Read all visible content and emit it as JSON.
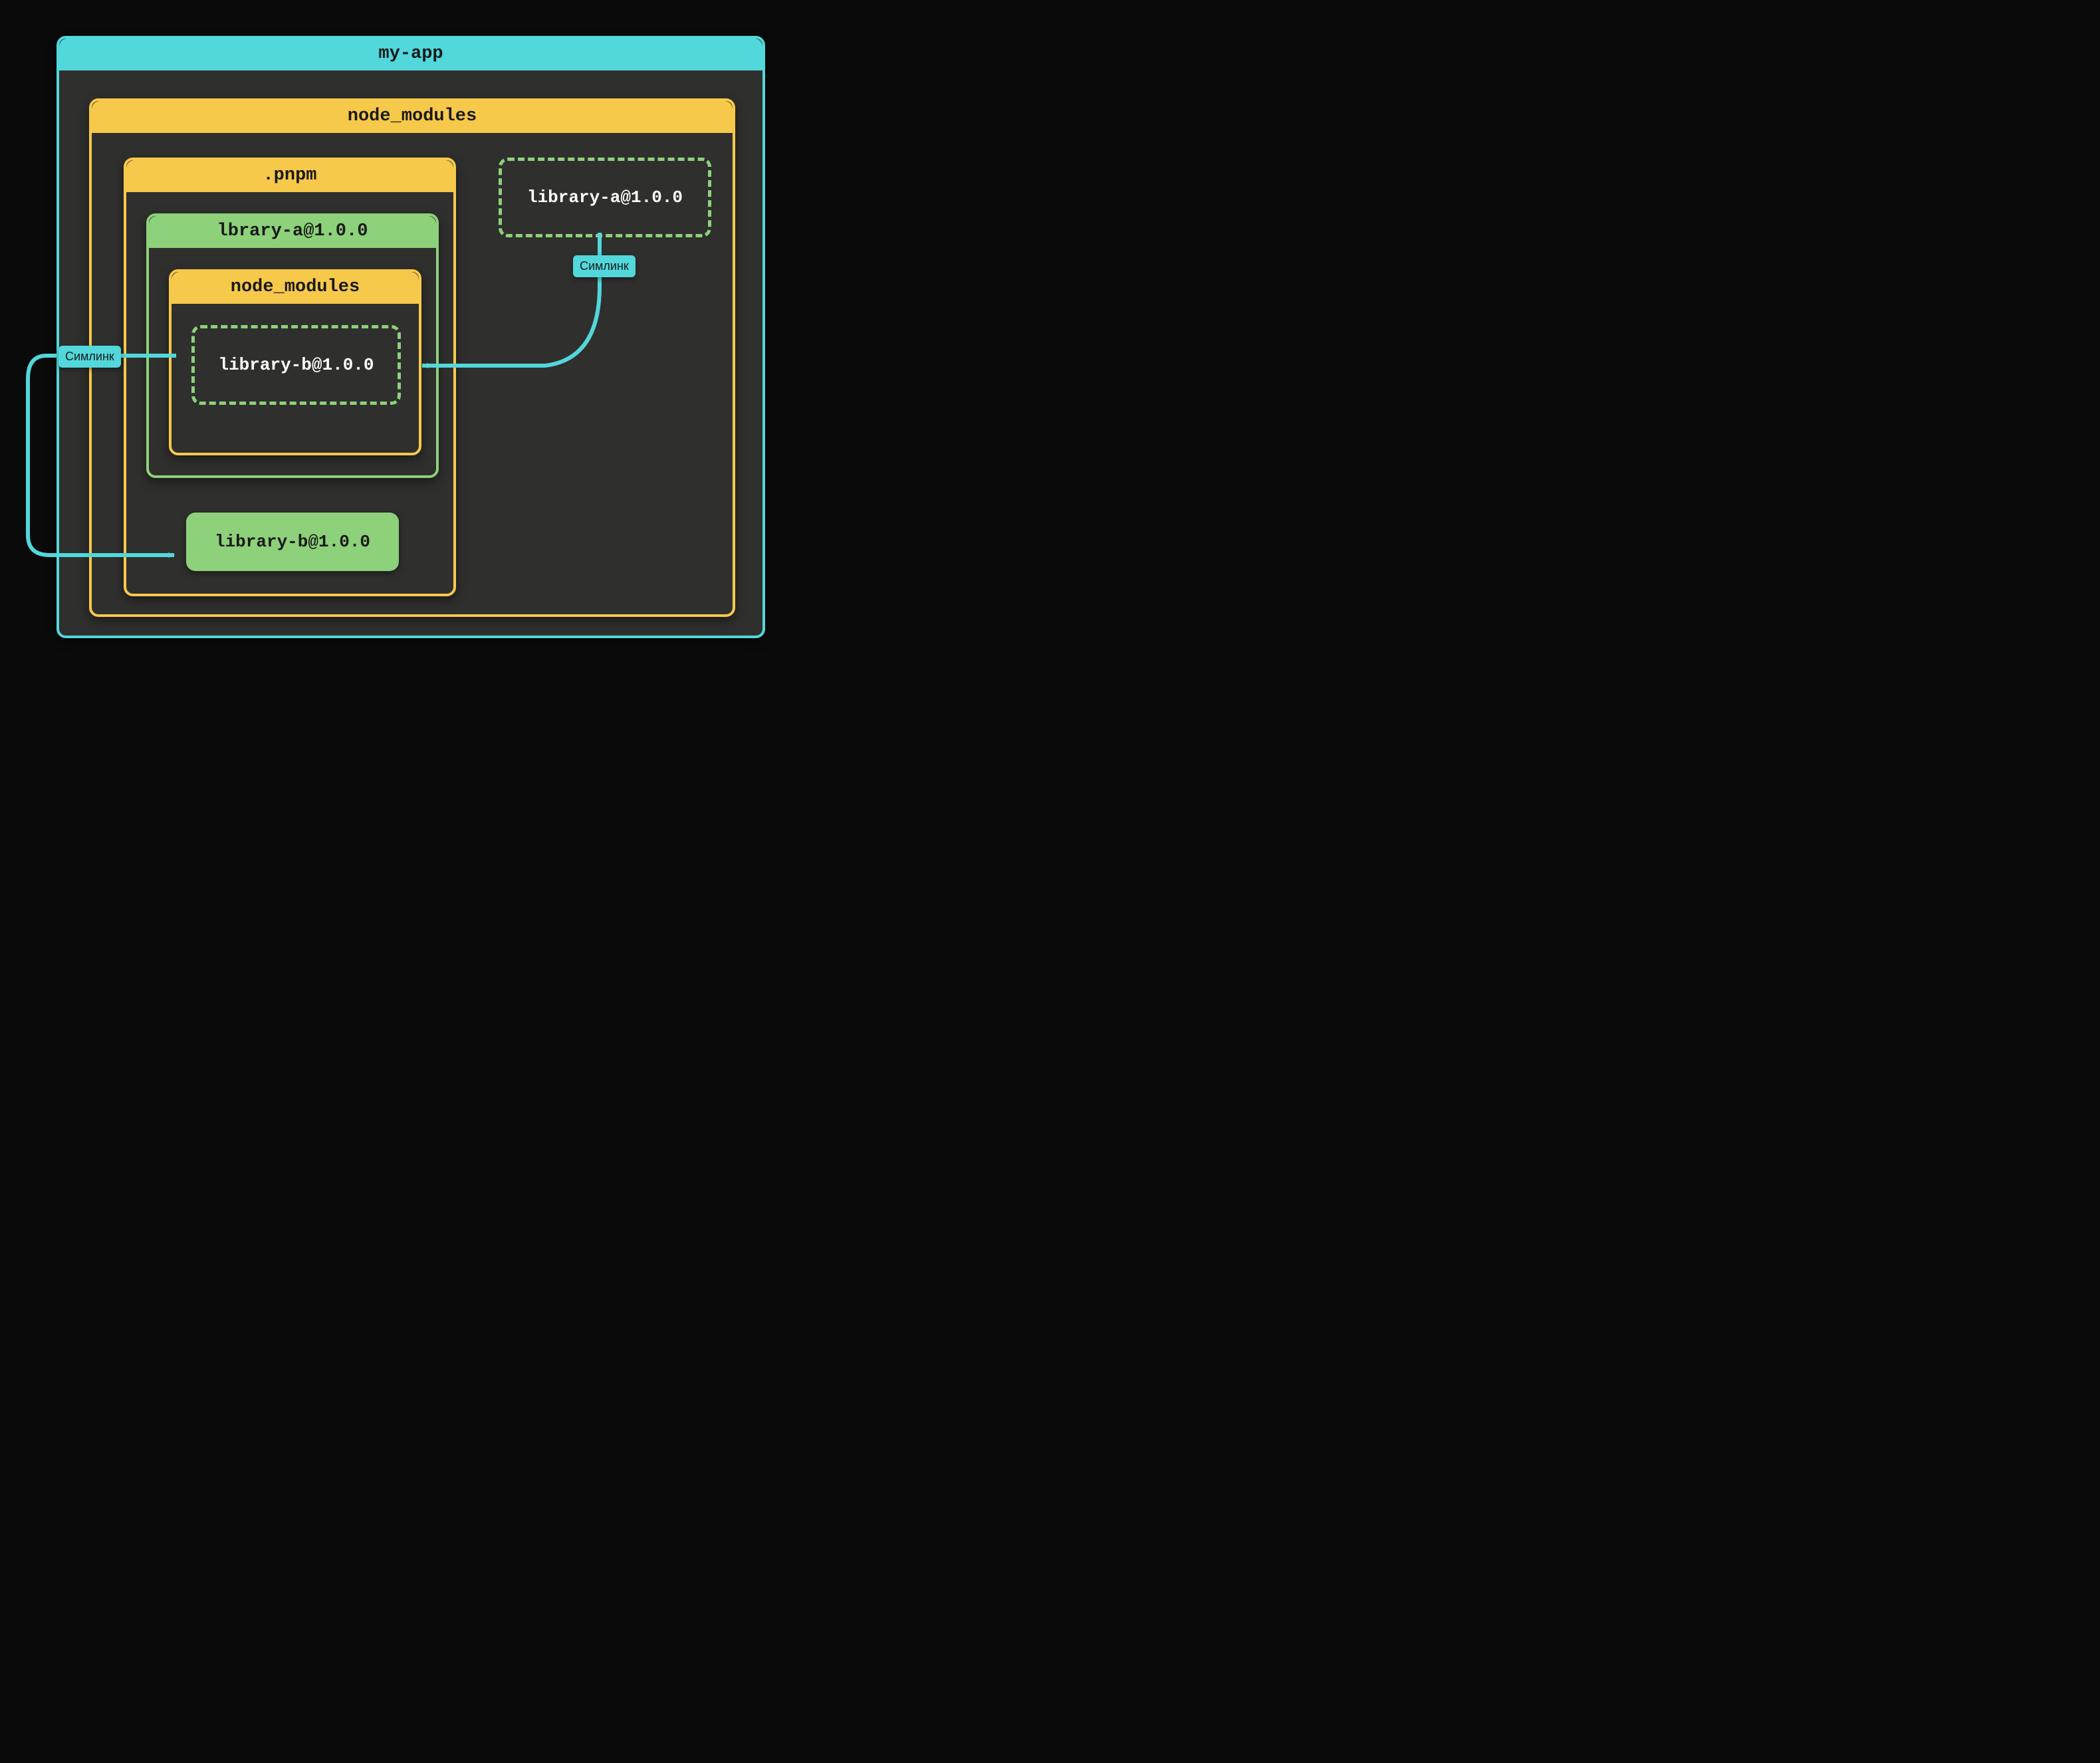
{
  "colors": {
    "teal": "#52d7db",
    "yellow": "#f6c94b",
    "green": "#8dd17a",
    "panel": "#2f2f2e",
    "bg": "#0a0a0a",
    "text_dark": "#1a1a1a",
    "text_light": "#ffffff"
  },
  "app": {
    "title": "my-app"
  },
  "node_modules_outer": {
    "title": "node_modules"
  },
  "pnpm": {
    "title": ".pnpm"
  },
  "library_a_folder": {
    "title": "lbrary-a@1.0.0"
  },
  "node_modules_inner": {
    "title": "node_modules"
  },
  "symlink_b_inner": {
    "label": "library-b@1.0.0"
  },
  "library_b_real": {
    "label": "library-b@1.0.0"
  },
  "symlink_a_top": {
    "label": "library-a@1.0.0"
  },
  "symlink_tag_left": "Симлинк",
  "symlink_tag_right": "Симлинк"
}
